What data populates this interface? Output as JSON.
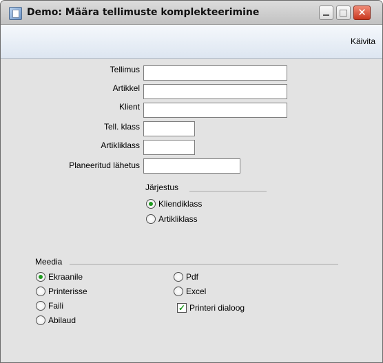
{
  "window": {
    "title": "Demo: Määra tellimuste komplekteerimine",
    "close_glyph": "✕"
  },
  "toolbar": {
    "run_label": "Käivita"
  },
  "form": {
    "fields": [
      {
        "label": "Tellimus",
        "value": ""
      },
      {
        "label": "Artikkel",
        "value": ""
      },
      {
        "label": "Klient",
        "value": ""
      },
      {
        "label": "Tell. klass",
        "value": ""
      },
      {
        "label": "Artikliklass",
        "value": ""
      },
      {
        "label": "Planeeritud lähetus",
        "value": ""
      }
    ]
  },
  "order": {
    "heading": "Järjestus",
    "options": [
      {
        "label": "Kliendiklass",
        "selected": true
      },
      {
        "label": "Artikliklass",
        "selected": false
      }
    ]
  },
  "media": {
    "heading": "Meedia",
    "options": [
      {
        "label": "Ekraanile",
        "selected": true
      },
      {
        "label": "Printerisse",
        "selected": false
      },
      {
        "label": "Faili",
        "selected": false
      },
      {
        "label": "Abilaud",
        "selected": false
      },
      {
        "label": "Pdf",
        "selected": false
      },
      {
        "label": "Excel",
        "selected": false
      }
    ],
    "printer_dialog": {
      "label": "Printeri dialoog",
      "checked": true,
      "check_glyph": "✓"
    }
  },
  "colors": {
    "accent_radio": "#1e9a1e",
    "close_button": "#c9371f",
    "toolbar": "#dde6f1"
  }
}
